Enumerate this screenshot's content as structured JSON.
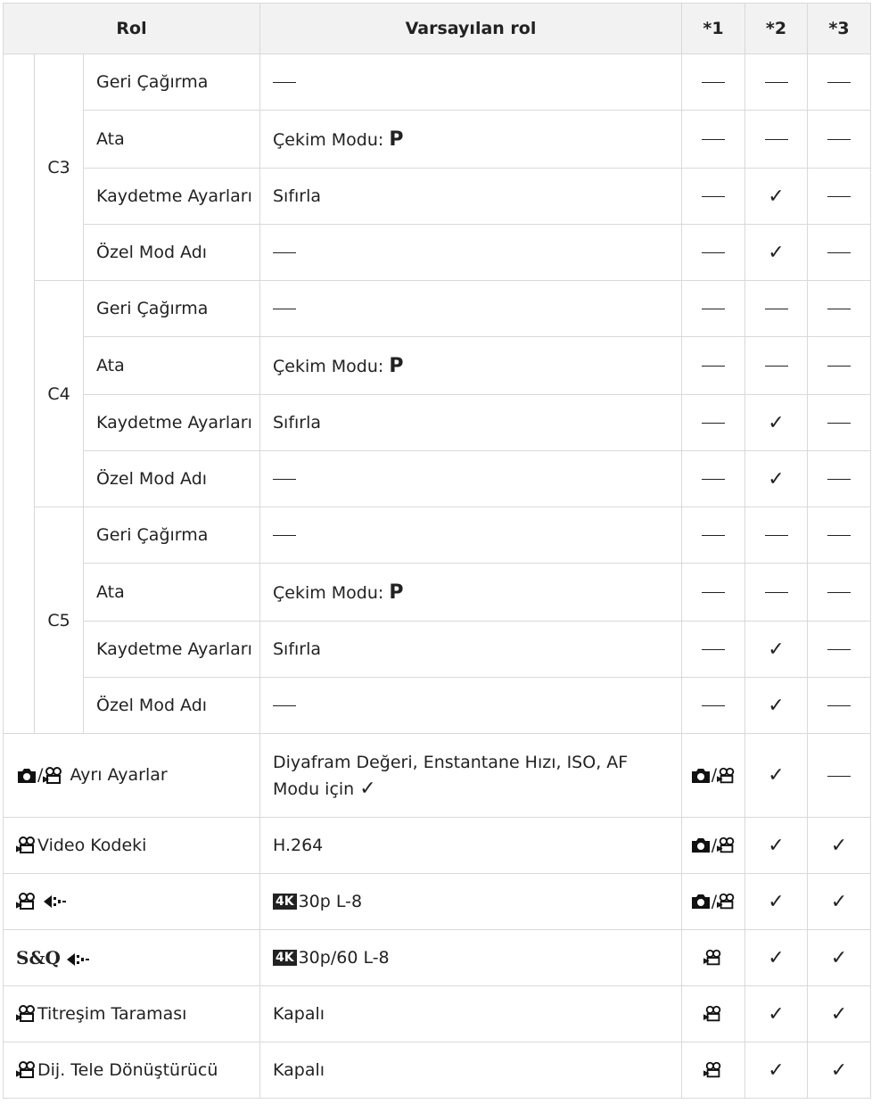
{
  "header": {
    "rol": "Rol",
    "default": "Varsayılan rol",
    "n1": "*1",
    "n2": "*2",
    "n3": "*3"
  },
  "groups": [
    {
      "name": "C3",
      "rows": [
        {
          "role": "Geri Çağırma",
          "def": "—",
          "n1": "—",
          "n2": "—",
          "n3": "—"
        },
        {
          "role": "Ata",
          "def_prefix": "Çekim Modu:",
          "def_bold": "P",
          "n1": "—",
          "n2": "—",
          "n3": "—"
        },
        {
          "role": "Kaydetme Ayarları",
          "def": "Sıfırla",
          "n1": "—",
          "n2": "✓",
          "n3": "—"
        },
        {
          "role": "Özel Mod Adı",
          "def": "—",
          "n1": "—",
          "n2": "✓",
          "n3": "—"
        }
      ]
    },
    {
      "name": "C4",
      "rows": [
        {
          "role": "Geri Çağırma",
          "def": "—",
          "n1": "—",
          "n2": "—",
          "n3": "—"
        },
        {
          "role": "Ata",
          "def_prefix": "Çekim Modu:",
          "def_bold": "P",
          "n1": "—",
          "n2": "—",
          "n3": "—"
        },
        {
          "role": "Kaydetme Ayarları",
          "def": "Sıfırla",
          "n1": "—",
          "n2": "✓",
          "n3": "—"
        },
        {
          "role": "Özel Mod Adı",
          "def": "—",
          "n1": "—",
          "n2": "✓",
          "n3": "—"
        }
      ]
    },
    {
      "name": "C5",
      "rows": [
        {
          "role": "Geri Çağırma",
          "def": "—",
          "n1": "—",
          "n2": "—",
          "n3": "—"
        },
        {
          "role": "Ata",
          "def_prefix": "Çekim Modu:",
          "def_bold": "P",
          "n1": "—",
          "n2": "—",
          "n3": "—"
        },
        {
          "role": "Kaydetme Ayarları",
          "def": "Sıfırla",
          "n1": "—",
          "n2": "✓",
          "n3": "—"
        },
        {
          "role": "Özel Mod Adı",
          "def": "—",
          "n1": "—",
          "n2": "✓",
          "n3": "—"
        }
      ]
    }
  ],
  "bottom_rows": [
    {
      "role": "Ayrı Ayarlar",
      "def_line1": "Diyafram Değeri, Enstantane Hızı, ISO, AF",
      "def_line2": "Modu için",
      "n1": "camera/video",
      "n2": "✓",
      "n3": "—"
    },
    {
      "role": "Video Kodeki",
      "def": "H.264",
      "n1": "camera/video",
      "n2": "✓",
      "n3": "✓"
    },
    {
      "role": "",
      "def_badge": "4K",
      "def": "30p L-8",
      "n1": "camera/video",
      "n2": "✓",
      "n3": "✓"
    },
    {
      "role_prefix": "S&Q",
      "def_badge": "4K",
      "def": "30p/60 L-8",
      "n1": "video",
      "n2": "✓",
      "n3": "✓"
    },
    {
      "role": "Titreşim Taraması",
      "def": "Kapalı",
      "n1": "video",
      "n2": "✓",
      "n3": "✓"
    },
    {
      "role": "Dij. Tele Dönüştürücü",
      "def": "Kapalı",
      "n1": "video",
      "n2": "✓",
      "n3": "✓"
    }
  ]
}
